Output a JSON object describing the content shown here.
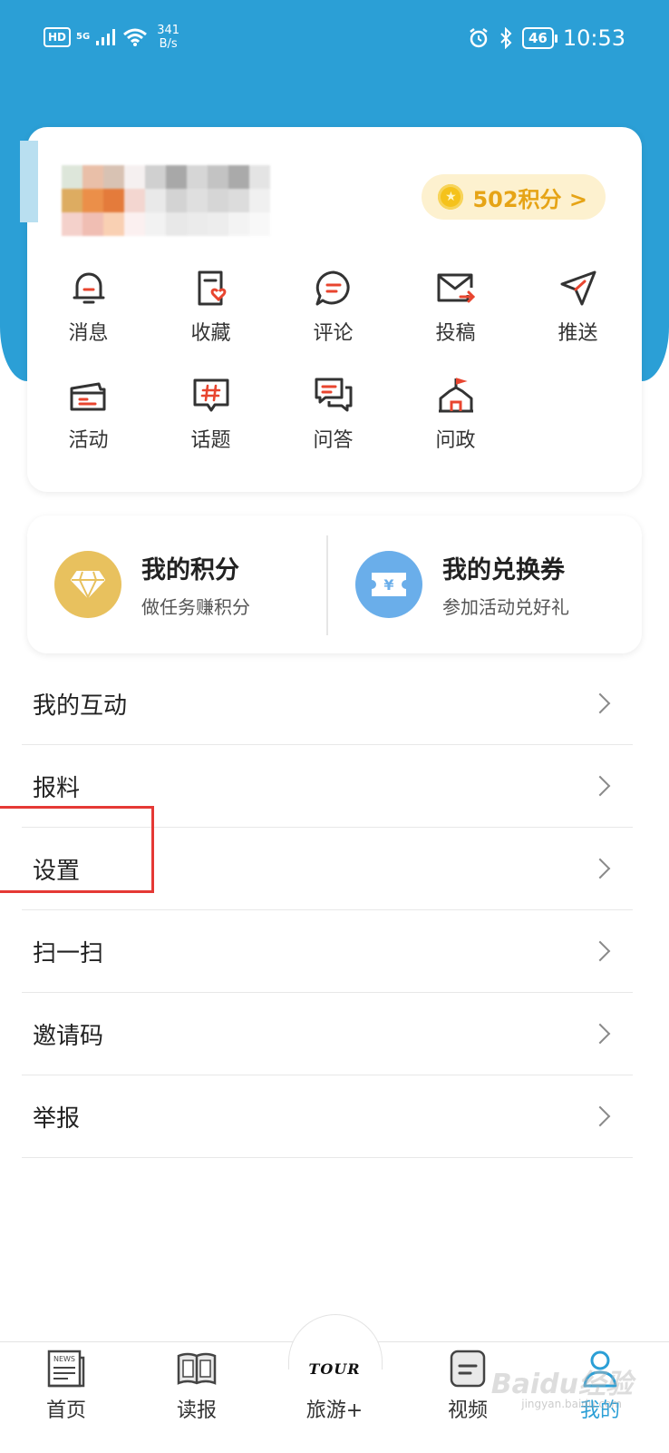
{
  "status_bar": {
    "hd": "HD",
    "network": "5G",
    "speed_value": "341",
    "speed_unit": "B/s",
    "battery": "46",
    "time": "10:53"
  },
  "profile": {
    "points_label": "502积分 >"
  },
  "grid": [
    {
      "label": "消息",
      "icon": "bell-icon"
    },
    {
      "label": "收藏",
      "icon": "favorite-doc-icon"
    },
    {
      "label": "评论",
      "icon": "comment-icon"
    },
    {
      "label": "投稿",
      "icon": "mail-send-icon"
    },
    {
      "label": "推送",
      "icon": "send-arrow-icon"
    },
    {
      "label": "活动",
      "icon": "ticket-icon"
    },
    {
      "label": "话题",
      "icon": "hashtag-icon"
    },
    {
      "label": "问答",
      "icon": "chat-bubbles-icon"
    },
    {
      "label": "问政",
      "icon": "government-building-icon"
    }
  ],
  "rewards": {
    "points": {
      "title": "我的积分",
      "subtitle": "做任务赚积分",
      "icon": "diamond-icon",
      "color": "#e8c15e"
    },
    "vouchers": {
      "title": "我的兑换券",
      "subtitle": "参加活动兑好礼",
      "icon": "voucher-icon",
      "color": "#6aaeea"
    }
  },
  "menu": [
    {
      "label": "我的互动"
    },
    {
      "label": "报料"
    },
    {
      "label": "设置"
    },
    {
      "label": "扫一扫"
    },
    {
      "label": "邀请码"
    },
    {
      "label": "举报"
    }
  ],
  "tabs": [
    {
      "label": "首页",
      "icon": "news-icon"
    },
    {
      "label": "读报",
      "icon": "newspaper-icon"
    },
    {
      "label": "旅游+",
      "icon": "tour-logo",
      "logo_text": "TOUR"
    },
    {
      "label": "视频",
      "icon": "video-icon"
    },
    {
      "label": "我的",
      "icon": "user-icon",
      "active": true
    }
  ],
  "watermark": {
    "text": "Baidu经验",
    "sub": "jingyan.baidu.com"
  },
  "colors": {
    "accent": "#2b9fd6",
    "icon_red": "#e8452f",
    "points_gold": "#e6a416"
  }
}
